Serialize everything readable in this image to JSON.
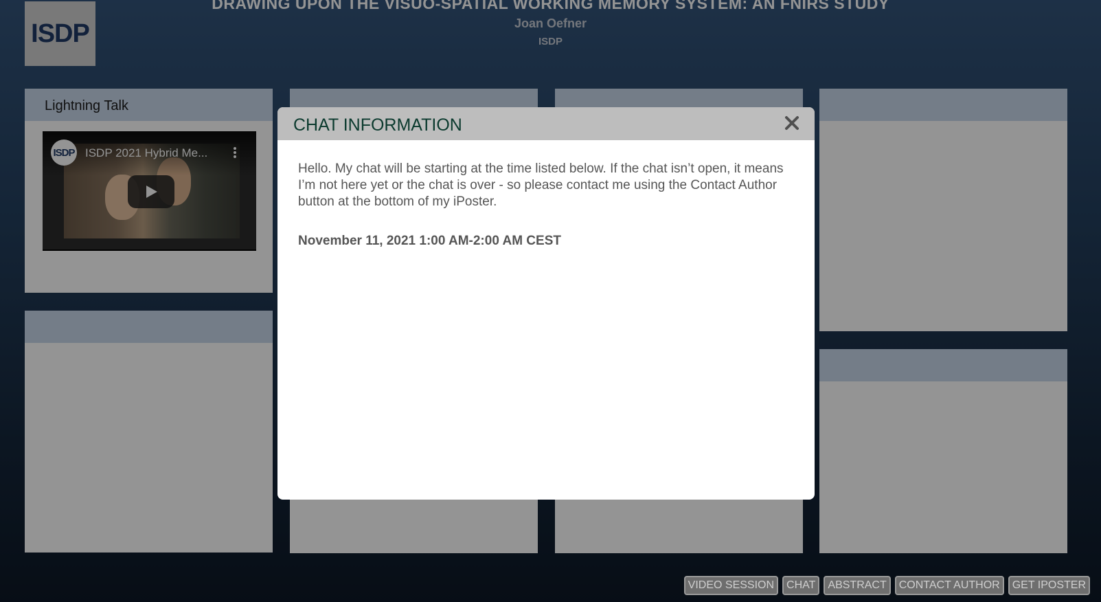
{
  "header": {
    "logo_text": "ISDP",
    "poster_title": "DRAWING UPON THE VISUO-SPATIAL WORKING MEMORY SYSTEM: AN FNIRS STUDY",
    "author": "Joan Oefner",
    "affiliation": "ISDP"
  },
  "panels": {
    "lightning_talk": {
      "title": "Lightning Talk",
      "video": {
        "channel_avatar_text": "ISDP",
        "title": "ISDP 2021 Hybrid Me...",
        "menu_icon": "kebab-icon",
        "play_icon": "play-icon"
      }
    }
  },
  "modal": {
    "title": "CHAT INFORMATION",
    "close_icon": "close-icon",
    "message": "Hello. My chat will be starting at the time listed below. If the chat isn’t open, it means I’m not here yet or the chat is over - so please contact me using the Contact Author button at the bottom of my iPoster.",
    "time": "November 11, 2021 1:00 AM-2:00 AM CEST"
  },
  "toolbar": {
    "video_session": "VIDEO SESSION",
    "chat": "CHAT",
    "abstract": "ABSTRACT",
    "contact_author": "CONTACT AUTHOR",
    "get_iposter": "GET IPOSTER"
  },
  "colors": {
    "overlay": "rgba(0,0,0,0.42)",
    "modal_header": "#bdbdbd",
    "modal_title": "#0b3a2e",
    "panel_header": "#c8d7ea"
  }
}
